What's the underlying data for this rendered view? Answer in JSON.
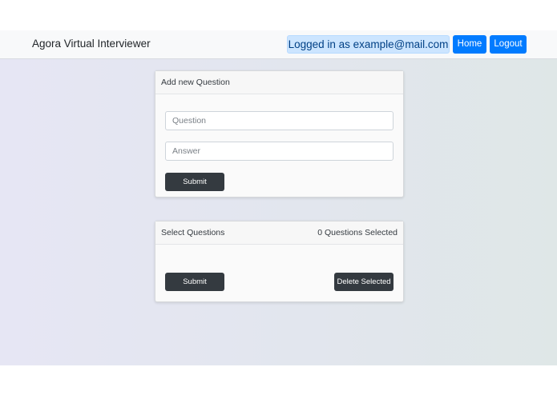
{
  "navbar": {
    "brand": "Agora Virtual Interviewer",
    "logged_in_text": "Logged in as example@mail.com",
    "home_label": "Home",
    "logout_label": "Logout",
    "accent_color": "#007bff"
  },
  "add_question_card": {
    "title": "Add new Question",
    "question_placeholder": "Question",
    "answer_placeholder": "Answer",
    "submit_label": "Submit"
  },
  "select_questions_card": {
    "title": "Select Questions",
    "selected_count_text": "0 Questions Selected",
    "submit_label": "Submit",
    "delete_label": "Delete Selected"
  }
}
